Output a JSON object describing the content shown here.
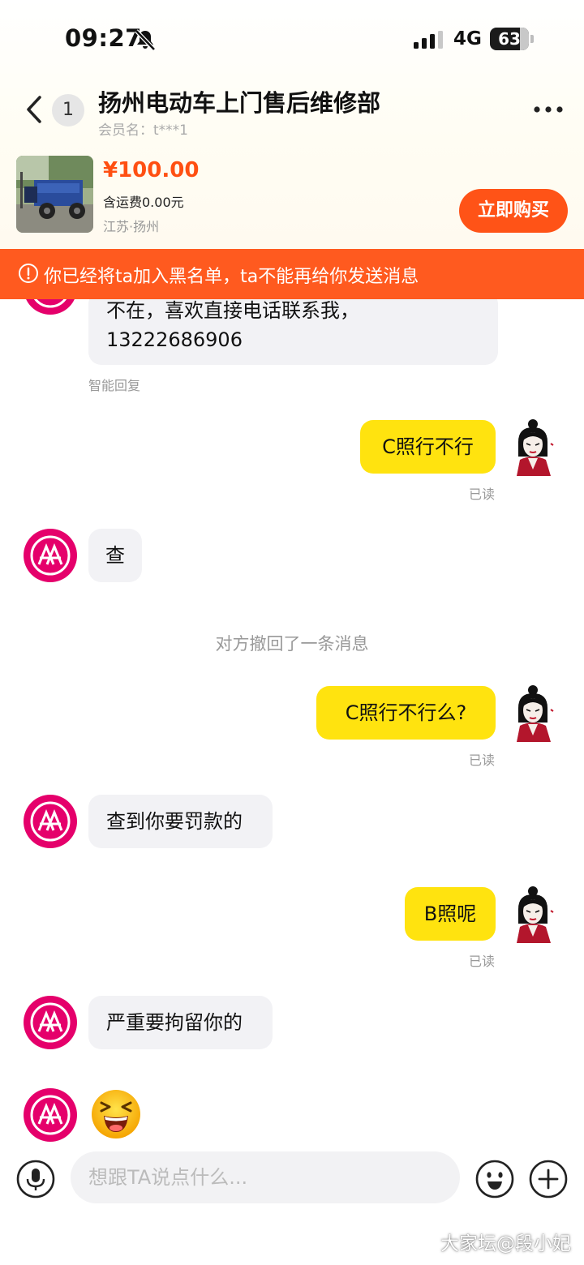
{
  "status_bar": {
    "time": "09:27",
    "network": "4G",
    "battery": "63"
  },
  "header": {
    "unread_count": "1",
    "title": "扬州电动车上门售后维修部",
    "member": "会员名：t***1"
  },
  "product": {
    "price": "¥100.00",
    "shipping": "含运费0.00元",
    "location": "江苏·扬州",
    "buy_label": "立即购买"
  },
  "banner": {
    "text": "你已经将ta加入黑名单，ta不能再给你发送消息",
    "color": "#ff5a1f"
  },
  "messages": {
    "m1_line1": "不在，喜欢直接电话联系我，",
    "m1_line2": "13222686906",
    "m1_tag": "智能回复",
    "m2": "C照行不行",
    "m2_status": "已读",
    "m3": "查",
    "recall": "对方撤回了一条消息",
    "m4": "C照行不行么?",
    "m4_status": "已读",
    "m5": "查到你要罚款的",
    "m6": "B照呢",
    "m6_status": "已读",
    "m7": "严重要拘留你的"
  },
  "input": {
    "placeholder": "想跟TA说点什么..."
  },
  "watermark": "大家坛@段小妃",
  "colors": {
    "accent": "#ff5317",
    "outgoing_bubble": "#ffe30f",
    "incoming_bubble": "#f2f2f5",
    "brand_avatar": "#e5006b"
  }
}
